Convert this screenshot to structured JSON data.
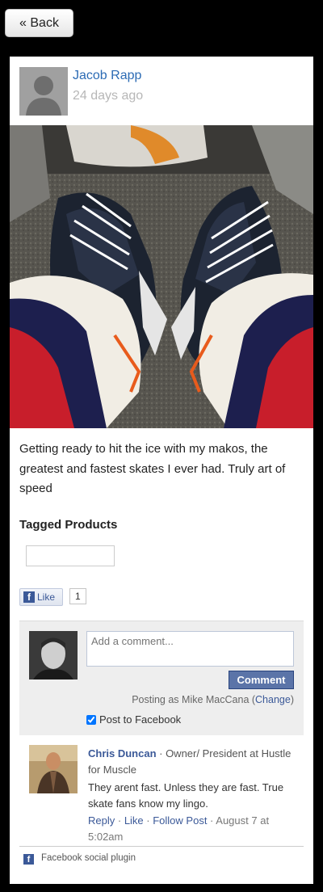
{
  "nav": {
    "back_label": "« Back"
  },
  "post": {
    "author": "Jacob Rapp",
    "time": "24 days ago",
    "caption": "Getting ready to hit the ice with my makos, the greatest and fastest skates I ever had. Truly art of speed",
    "tagged_title": "Tagged Products"
  },
  "like": {
    "label": "Like",
    "count": "1"
  },
  "comment_form": {
    "placeholder": "Add a comment...",
    "submit_label": "Comment",
    "posting_as_prefix": "Posting as Mike MacCana (",
    "change_label": "Change",
    "posting_as_suffix": ")",
    "post_to_facebook_label": "Post to Facebook"
  },
  "comments": [
    {
      "name": "Chris Duncan",
      "meta": " · Owner/ President at Hustle for Muscle",
      "text": "They arent fast. Unless they are fast. True skate fans know my lingo.",
      "reply_label": "Reply",
      "like_label": "Like",
      "follow_label": "Follow Post",
      "date": "August 7 at 5:02am"
    }
  ],
  "footer": {
    "plugin_label": "Facebook social plugin"
  },
  "colors": {
    "link": "#3b5998",
    "author_link": "#2c6bb4",
    "comment_button": "#5b74a8"
  }
}
